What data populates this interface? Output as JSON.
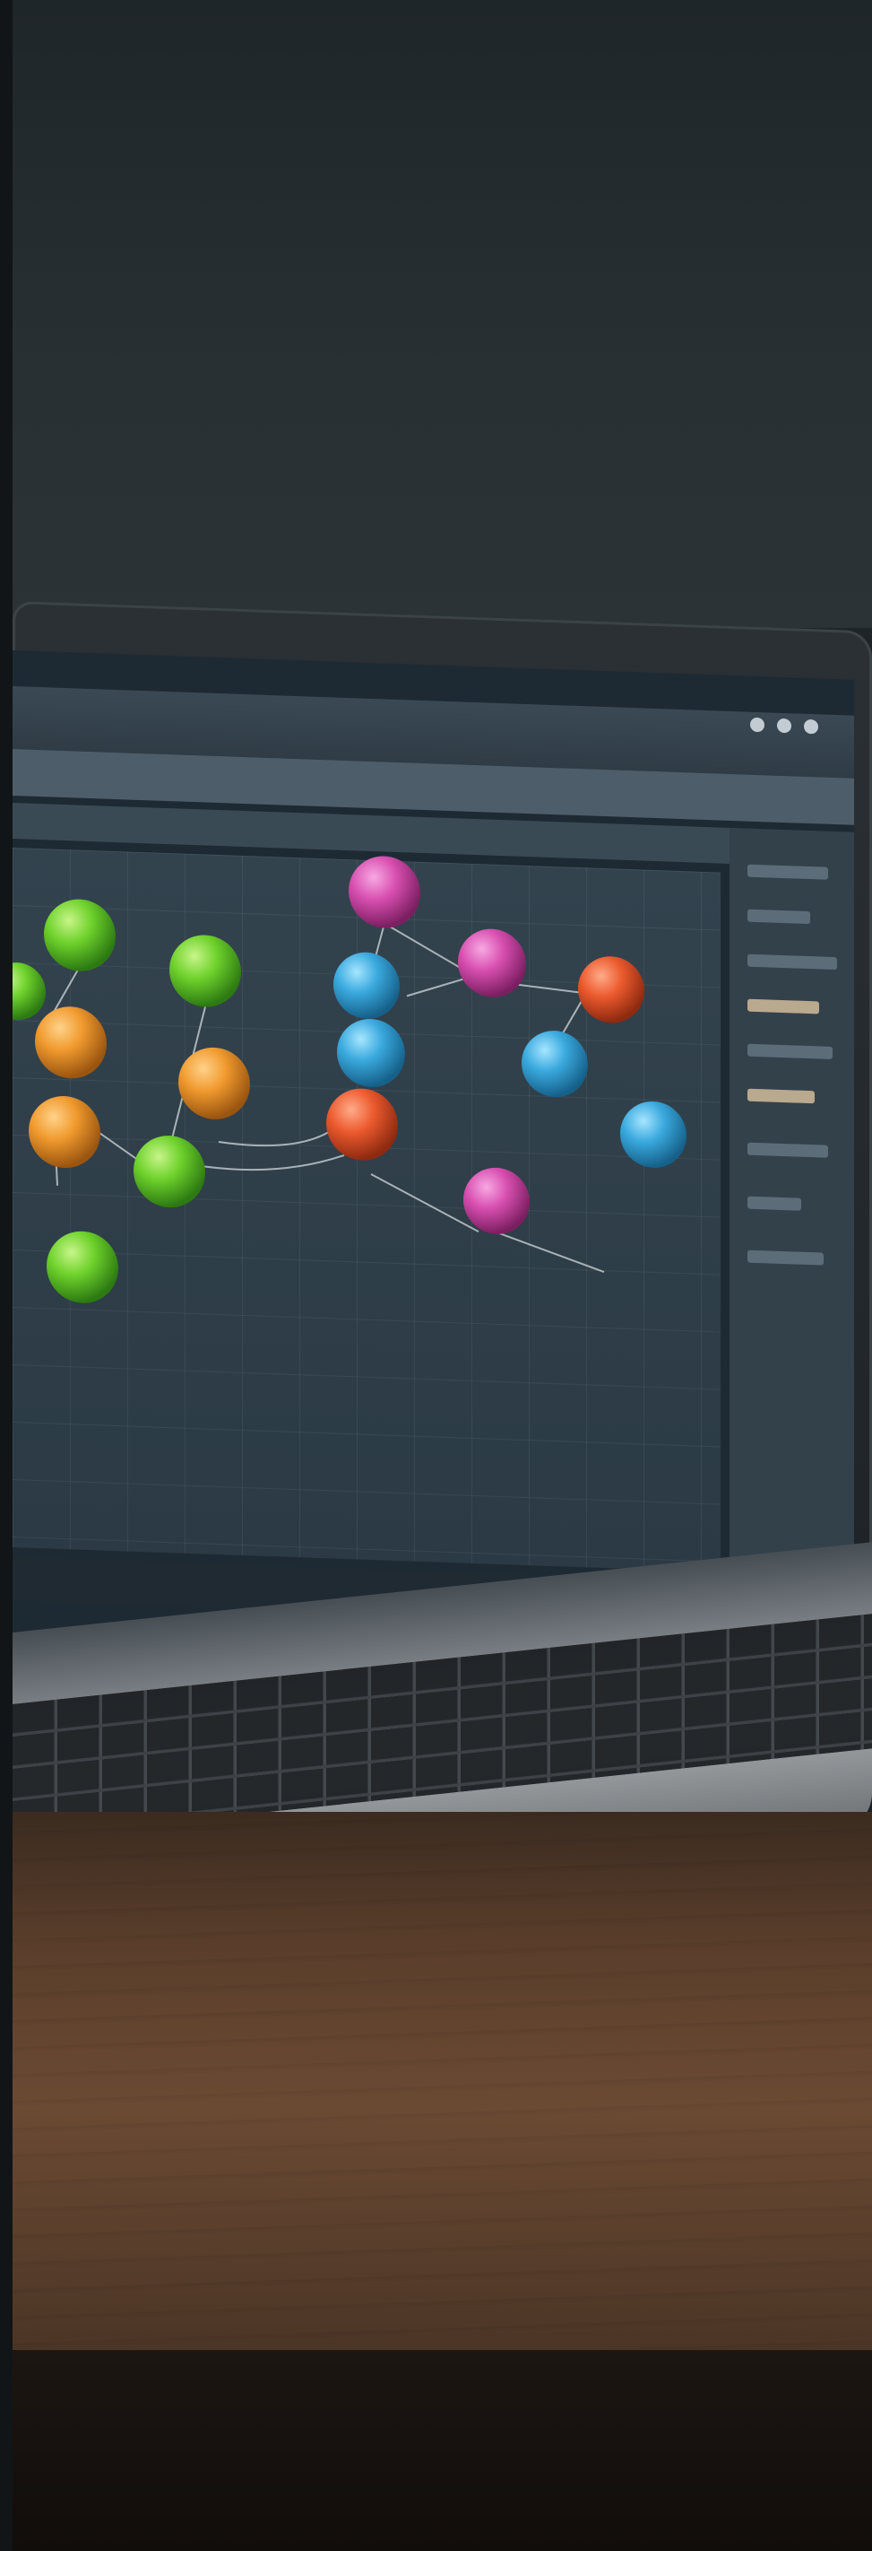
{
  "scene": {
    "description_type": "photo of laptop showing network graph application",
    "colors": {
      "wall": "#262e32",
      "desk_wood": "#6b4a33",
      "screen_bg": "#2b3a44",
      "node_green": "#6fd22c",
      "node_orange": "#f09a2e",
      "node_red": "#ec5a2e",
      "node_blue": "#3aa9de",
      "node_magenta": "#d84fb0"
    }
  },
  "screen": {
    "app_title": "",
    "menu": [],
    "toolbar": [],
    "nodes": [
      {
        "color": "green"
      },
      {
        "color": "green"
      },
      {
        "color": "green"
      },
      {
        "color": "green"
      },
      {
        "color": "green"
      },
      {
        "color": "orange"
      },
      {
        "color": "orange"
      },
      {
        "color": "orange"
      },
      {
        "color": "magenta"
      },
      {
        "color": "magenta"
      },
      {
        "color": "magenta"
      },
      {
        "color": "blue"
      },
      {
        "color": "blue"
      },
      {
        "color": "blue"
      },
      {
        "color": "blue"
      },
      {
        "color": "red"
      },
      {
        "color": "red"
      }
    ]
  }
}
